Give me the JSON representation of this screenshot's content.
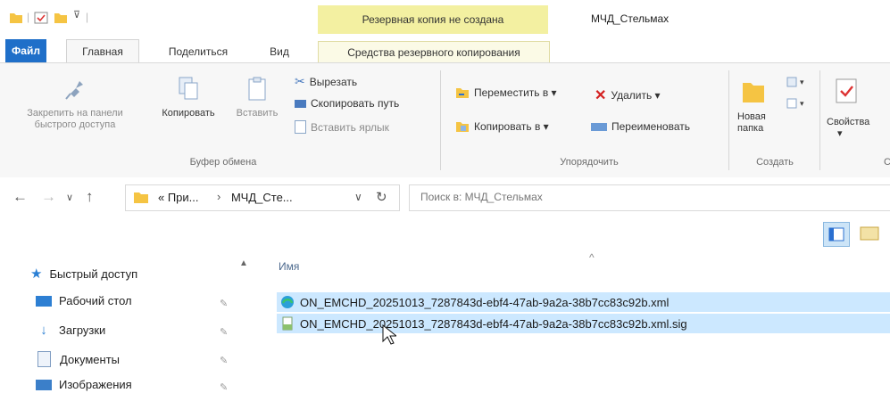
{
  "title_bar": {
    "context_banner": "Резервная копия не создана",
    "window_title": "МЧД_Стельмах"
  },
  "tabs": [
    "Файл",
    "Главная",
    "Поделиться",
    "Вид",
    "Средства резервного копирования"
  ],
  "ribbon": {
    "clipboard": {
      "pin_label_1": "Закрепить на панели",
      "pin_label_2": "быстрого доступа",
      "copy": "Копировать",
      "paste": "Вставить",
      "cut": "Вырезать",
      "copy_path": "Скопировать путь",
      "paste_shortcut": "Вставить ярлык",
      "group": "Буфер обмена"
    },
    "organize": {
      "move_to": "Переместить в ▾",
      "copy_to": "Копировать в ▾",
      "delete": "Удалить ▾",
      "rename": "Переименовать",
      "group": "Упорядочить"
    },
    "new": {
      "new_folder_1": "Новая",
      "new_folder_2": "папка",
      "group": "Создать"
    },
    "open": {
      "properties": "Свойства",
      "properties_arrow": "▾",
      "group_partial": "С"
    }
  },
  "address": {
    "crumb_1": "«  При...",
    "crumb_sep": "›",
    "crumb_2": "МЧД_Сте...",
    "dropdown": "∨",
    "refresh": "↻",
    "search_placeholder": "Поиск в: МЧД_Стельмах"
  },
  "nav_pane": {
    "items": [
      {
        "label": "Быстрый доступ"
      },
      {
        "label": "Рабочий стол"
      },
      {
        "label": "Загрузки"
      },
      {
        "label": "Документы"
      },
      {
        "label": "Изображения"
      }
    ]
  },
  "content": {
    "column_header": "Имя",
    "files": [
      {
        "name": "ON_EMCHD_20251013_7287843d-ebf4-47ab-9a2a-38b7cc83c92b.xml"
      },
      {
        "name": "ON_EMCHD_20251013_7287843d-ebf4-47ab-9a2a-38b7cc83c92b.xml.sig"
      }
    ]
  },
  "colors": {
    "file_tab": "#1f6fc9",
    "context_banner": "#f3f0a1",
    "selection": "#cce8ff"
  }
}
